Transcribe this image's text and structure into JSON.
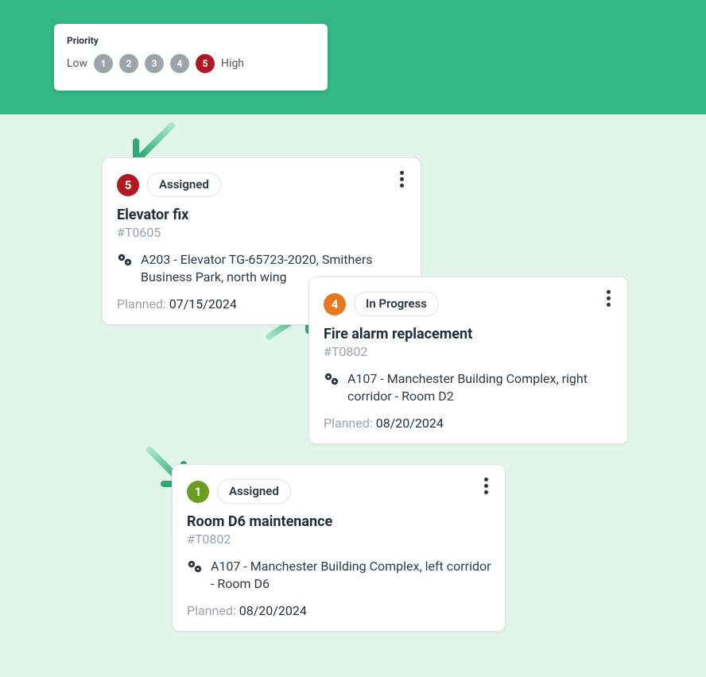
{
  "priority_panel": {
    "label": "Priority",
    "low": "Low",
    "high": "High",
    "levels": [
      "1",
      "2",
      "3",
      "4",
      "5"
    ]
  },
  "cards": [
    {
      "priority": "5",
      "status": "Assigned",
      "title": "Elevator fix",
      "id": "#T0605",
      "location": "A203 - Elevator TG-65723-2020, Smithers Business Park, north wing",
      "planned_label": "Planned: ",
      "planned_date": "07/15/2024",
      "badge_color": "red"
    },
    {
      "priority": "4",
      "status": "In Progress",
      "title": "Fire alarm replacement",
      "id": "#T0802",
      "location": "A107 - Manchester Building Complex, right corridor - Room D2",
      "planned_label": "Planned: ",
      "planned_date": "08/20/2024",
      "badge_color": "orange"
    },
    {
      "priority": "1",
      "status": "Assigned",
      "title": "Room D6 maintenance",
      "id": "#T0802",
      "location": "A107 - Manchester Building Complex, left corridor - Room D6",
      "planned_label": "Planned: ",
      "planned_date": "08/20/2024",
      "badge_color": "olive"
    }
  ]
}
